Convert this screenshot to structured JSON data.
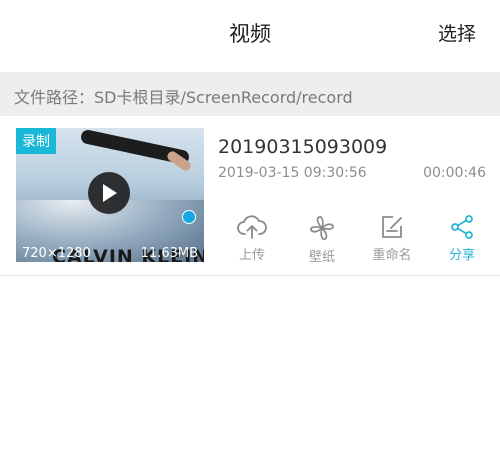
{
  "header": {
    "title": "视频",
    "select_label": "选择"
  },
  "path": {
    "text": "文件路径：SD卡根目录/ScreenRecord/record"
  },
  "item": {
    "badge": "录制",
    "brand": "CALVIN KLEIN",
    "resolution": "720×1280",
    "size": "11.63MB",
    "name": "20190315093009",
    "date": "2019-03-15 09:30:56",
    "duration": "00:00:46",
    "actions": [
      {
        "label": "上传",
        "icon": "cloud-upload-icon"
      },
      {
        "label": "壁纸",
        "icon": "wallpaper-icon"
      },
      {
        "label": "重命名",
        "icon": "rename-icon"
      },
      {
        "label": "分享",
        "icon": "share-icon"
      }
    ]
  },
  "colors": {
    "accent": "#26b4d8",
    "path_bg": "#eeeeee",
    "muted": "#8d8d8d"
  }
}
